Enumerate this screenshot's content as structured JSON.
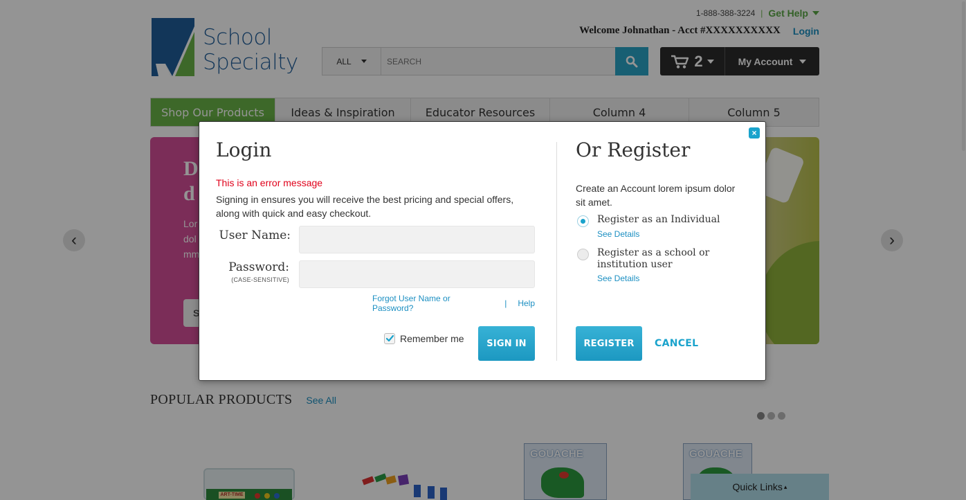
{
  "brand": {
    "name_line1": "School",
    "name_line2": "Specialty"
  },
  "header": {
    "phone": "1-888-388-3224",
    "separator": "|",
    "get_help": "Get Help",
    "welcome": "Welcome Johnathan - Acct #XXXXXXXXXX",
    "login": "Login"
  },
  "search": {
    "scope": "ALL",
    "placeholder": "SEARCH"
  },
  "cart": {
    "count": "2",
    "account_label": "My Account"
  },
  "nav": {
    "items": [
      "Shop Our Products",
      "Ideas & Inspiration",
      "Educator Resources",
      "Column 4",
      "Column 5"
    ]
  },
  "hero": {
    "title": "D\nd",
    "text": "Lor\ndol\nmm",
    "button": "S"
  },
  "carousel": {
    "prev": "‹",
    "next": "›"
  },
  "popular": {
    "title": "POPULAR PRODUCTS",
    "see_all": "See All"
  },
  "products": {
    "label_1": "GOUACHE",
    "label_2": "GOUACHE",
    "label_3": "ART-TIME"
  },
  "quick_links": {
    "label": "Quick Links",
    "arrow": "▴"
  },
  "modal": {
    "close_label": "×",
    "login": {
      "title": "Login",
      "error": "This is an error message",
      "intro": "Signing in ensures you will receive the best pricing and special offers, along with quick and easy checkout.",
      "username_label": "User Name:",
      "password_label": "Password:",
      "password_sub": "(CASE-SENSITIVE)",
      "username_value": "",
      "password_value": "",
      "forgot": "Forgot User Name or Password?",
      "separator": "|",
      "help": "Help",
      "remember": "Remember me",
      "remember_checked": true,
      "sign_in": "SIGN IN"
    },
    "register": {
      "title": "Or Register",
      "intro": "Create an Account lorem ipsum dolor sit amet.",
      "options": [
        {
          "label": "Register as an Individual",
          "details": "See Details",
          "selected": true
        },
        {
          "label": "Register as a school or institution user",
          "details": "See Details",
          "selected": false
        }
      ],
      "register_button": "REGISTER",
      "cancel": "CANCEL"
    }
  },
  "colors": {
    "accent": "#1aa3cc",
    "green": "#6ab347",
    "error": "#e0001a",
    "brand_blue": "#1f5d99"
  }
}
